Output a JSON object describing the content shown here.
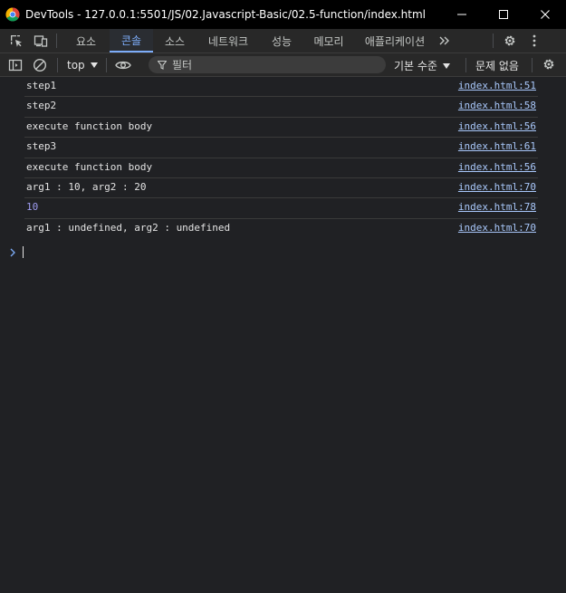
{
  "window": {
    "title": "DevTools - 127.0.0.1:5501/JS/02.Javascript-Basic/02.5-function/index.html",
    "controls": [
      "minimize",
      "maximize",
      "close"
    ]
  },
  "tabs": [
    {
      "label": "요소"
    },
    {
      "label": "콘솔",
      "active": true
    },
    {
      "label": "소스"
    },
    {
      "label": "네트워크"
    },
    {
      "label": "성능"
    },
    {
      "label": "메모리"
    },
    {
      "label": "애플리케이션"
    }
  ],
  "toolbar": {
    "context": "top",
    "filter_placeholder": "필터",
    "level": "기본 수준",
    "issues": "문제 없음"
  },
  "console": {
    "rows": [
      {
        "text": "step1",
        "source": "index.html:51"
      },
      {
        "text": "step2",
        "source": "index.html:58"
      },
      {
        "text": "execute function body",
        "source": "index.html:56"
      },
      {
        "text": "step3",
        "source": "index.html:61"
      },
      {
        "text": "execute function body",
        "source": "index.html:56"
      },
      {
        "text": "arg1 : 10, arg2 : 20",
        "source": "index.html:70"
      },
      {
        "text": "10",
        "source": "index.html:78",
        "kind": "number"
      },
      {
        "text": "arg1 : undefined, arg2 : undefined",
        "source": "index.html:70"
      }
    ]
  },
  "icons": {
    "inspect": "inspect-element-icon",
    "device": "device-toolbar-icon",
    "more_tabs": "more-tabs-icon",
    "settings": "settings-gear-icon",
    "kebab": "more-options-icon",
    "sidebar": "sidebar-toggle-icon",
    "clear": "clear-console-icon",
    "eye": "live-expression-eye-icon",
    "filter": "filter-funnel-icon"
  },
  "colors": {
    "background": "#202124",
    "accent": "#7cacf8",
    "link": "#a8c7fa",
    "number": "#9e9cf0"
  }
}
